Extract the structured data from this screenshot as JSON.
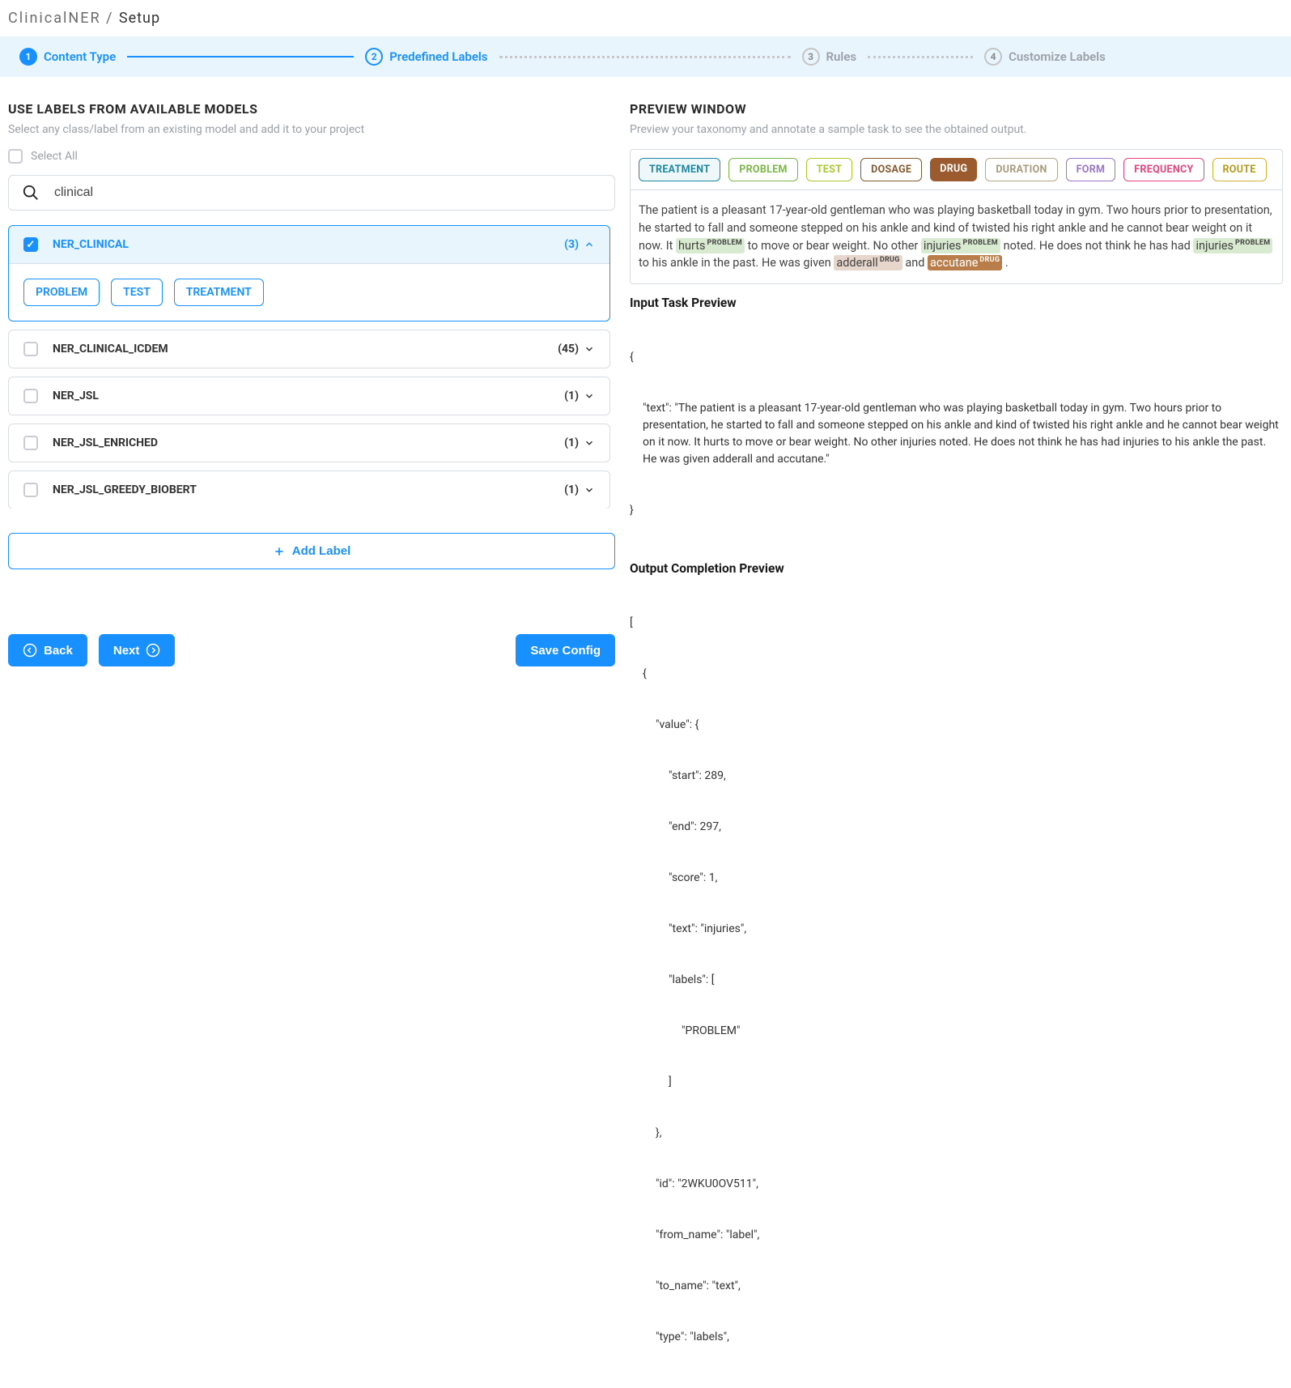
{
  "breadcrumb": {
    "project": "ClinicalNER",
    "page": "Setup"
  },
  "steps": [
    {
      "num": "1",
      "label": "Content Type"
    },
    {
      "num": "2",
      "label": "Predefined Labels"
    },
    {
      "num": "3",
      "label": "Rules"
    },
    {
      "num": "4",
      "label": "Customize Labels"
    }
  ],
  "left": {
    "title": "USE LABELS FROM AVAILABLE MODELS",
    "subtitle": "Select any class/label from an existing model and add it to your project",
    "select_all": "Select All",
    "search_value": "clinical",
    "add_label": "Add Label"
  },
  "models": [
    {
      "name": "NER_CLINICAL",
      "count": "(3)",
      "expanded": true,
      "checked": true,
      "labels": [
        "PROBLEM",
        "TEST",
        "TREATMENT"
      ]
    },
    {
      "name": "NER_CLINICAL_ICDEM",
      "count": "(45)",
      "expanded": false,
      "checked": false
    },
    {
      "name": "NER_JSL",
      "count": "(1)",
      "expanded": false,
      "checked": false
    },
    {
      "name": "NER_JSL_ENRICHED",
      "count": "(1)",
      "expanded": false,
      "checked": false
    },
    {
      "name": "NER_JSL_GREEDY_BIOBERT",
      "count": "(1)",
      "expanded": false,
      "checked": false
    }
  ],
  "buttons": {
    "back": "Back",
    "next": "Next",
    "save": "Save Config"
  },
  "right": {
    "title": "PREVIEW WINDOW",
    "subtitle": "Preview your taxonomy and annotate a sample task to see the obtained output.",
    "tags": [
      "TREATMENT",
      "PROBLEM",
      "TEST",
      "DOSAGE",
      "DRUG",
      "DURATION",
      "FORM",
      "FREQUENCY",
      "ROUTE"
    ],
    "text_pre1": "The patient is a pleasant 17-year-old gentleman who was playing basketball today in gym. Two hours prior to presentation, he started to fall and someone stepped on his ankle and kind of twisted his right ankle and he cannot bear weight on it now. It ",
    "ann1": "hurts",
    "ann1_lbl": "PROBLEM",
    "text_mid1": " to move or bear weight. No other ",
    "ann2": "injuries",
    "ann2_lbl": "PROBLEM",
    "text_mid2": " noted. He does not think he has had ",
    "ann3": "injuries",
    "ann3_lbl": "PROBLEM",
    "text_mid3": " to his ankle in the past. He was given ",
    "ann4": "adderall",
    "ann4_lbl": "DRUG",
    "text_mid4": " and ",
    "ann5": "accutane",
    "ann5_lbl": "DRUG",
    "text_end": ".",
    "input_title": "Input Task Preview",
    "input_json_text": "\"text\": \"The patient is a pleasant 17-year-old gentleman who was playing basketball today in gym. Two hours prior to presentation, he started to fall and someone stepped on his ankle and kind of twisted his right ankle and he cannot bear weight on it now. It hurts to move or bear weight. No other injuries noted. He does not think he has had injuries to his ankle the past. He was given adderall and accutane.\"",
    "output_title": "Output Completion Preview",
    "output": {
      "open_arr": "[",
      "open_obj": "{",
      "value_open": "\"value\": {",
      "start": "\"start\": 289,",
      "end": "\"end\": 297,",
      "score": "\"score\": 1,",
      "text": "\"text\": \"injuries\",",
      "labels_open": "\"labels\": [",
      "labels_val": "\"PROBLEM\"",
      "labels_close": "]",
      "value_close": "},",
      "id": "\"id\": \"2WKU0OV511\",",
      "from_name": "\"from_name\": \"label\",",
      "to_name": "\"to_name\": \"text\",",
      "type": "\"type\": \"labels\","
    }
  }
}
